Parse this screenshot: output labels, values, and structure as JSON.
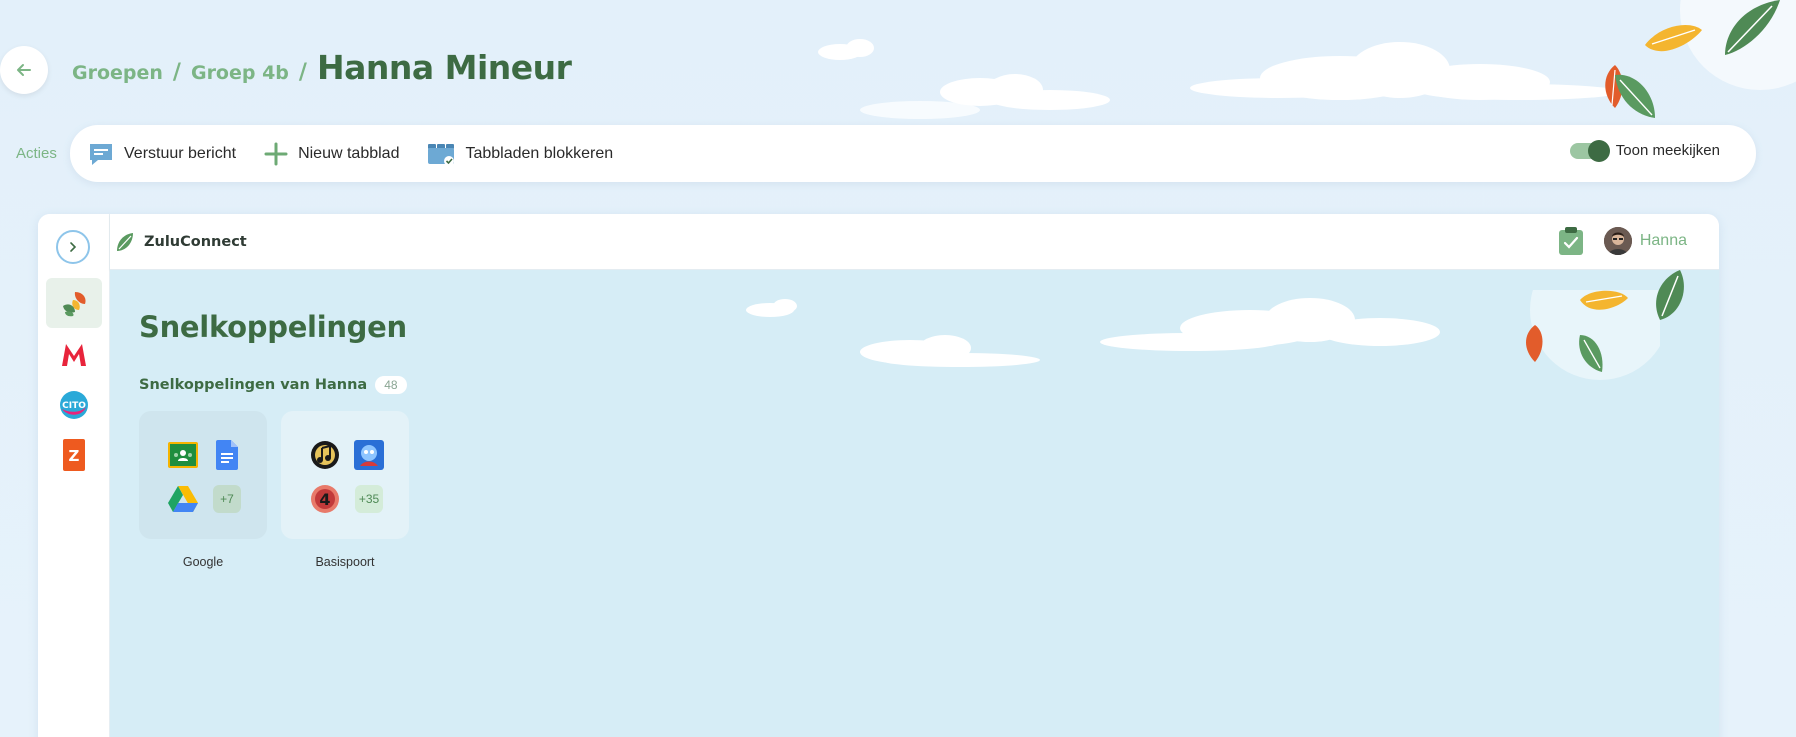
{
  "breadcrumb": {
    "items": [
      "Groepen",
      "Groep 4b"
    ],
    "separator": "/",
    "current": "Hanna Mineur"
  },
  "actions": {
    "label": "Acties",
    "send_message": "Verstuur bericht",
    "new_tab": "Nieuw tabblad",
    "block_tabs": "Tabbladen blokkeren",
    "watch_toggle_label": "Toon meekijken",
    "watch_toggle_on": true
  },
  "browser": {
    "brand": "ZuluConnect",
    "user_name": "Hanna",
    "sidebar_apps": [
      "zulu-leaf-app",
      "malmberg-m-app",
      "cito-app",
      "zuludesk-z-app"
    ],
    "page_title": "Snelkoppelingen",
    "section_title": "Snelkoppelingen van Hanna",
    "section_count": "48",
    "folders": [
      {
        "name": "Google",
        "more": "+7"
      },
      {
        "name": "Basispoort",
        "more": "+35"
      }
    ]
  },
  "colors": {
    "accent_green": "#3d6b43",
    "light_green": "#7cb585",
    "content_bg": "#d6edf6",
    "page_bg": "#e3f0fa"
  }
}
